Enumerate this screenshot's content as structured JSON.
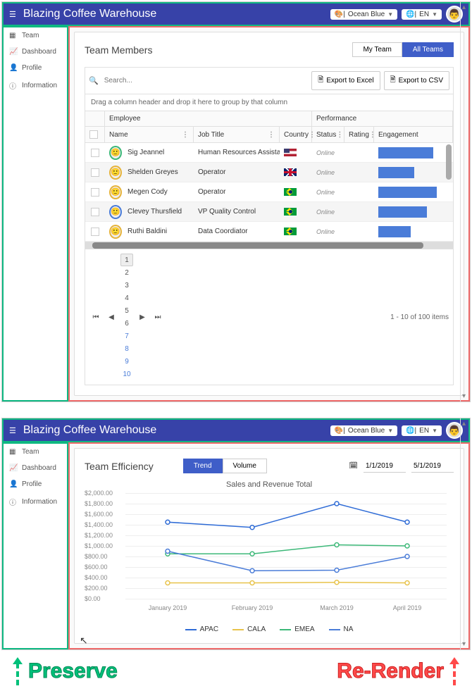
{
  "app_title": "Blazing Coffee Warehouse",
  "theme_dd": "Ocean Blue",
  "lang_dd": "EN",
  "sidebar": {
    "items": [
      {
        "icon": "grid",
        "label": "Team"
      },
      {
        "icon": "chart",
        "label": "Dashboard"
      },
      {
        "icon": "user",
        "label": "Profile"
      },
      {
        "icon": "info",
        "label": "Information"
      }
    ]
  },
  "panel1": {
    "title": "Team Members",
    "seg": {
      "my": "My Team",
      "all": "All Teams"
    },
    "search_placeholder": "Search...",
    "export_excel": "Export to Excel",
    "export_csv": "Export to CSV",
    "group_hint": "Drag a column header and drop it here to group by that column",
    "group_headers": {
      "employee": "Employee",
      "performance": "Performance"
    },
    "headers": {
      "name": "Name",
      "job": "Job Title",
      "country": "Country",
      "status": "Status",
      "rating": "Rating",
      "engagement": "Engagement"
    },
    "rows": [
      {
        "name": "Sig Jeannel",
        "job": "Human Resources Assistant III",
        "flag": "us",
        "status": "Online",
        "eng": 85,
        "ring": "#3cb878"
      },
      {
        "name": "Shelden Greyes",
        "job": "Operator",
        "flag": "uk",
        "status": "Online",
        "eng": 55,
        "ring": "#e6b33a"
      },
      {
        "name": "Megen Cody",
        "job": "Operator",
        "flag": "br",
        "status": "Online",
        "eng": 90,
        "ring": "#e6b33a"
      },
      {
        "name": "Clevey Thursfield",
        "job": "VP Quality Control",
        "flag": "br",
        "status": "Online",
        "eng": 75,
        "ring": "#4a7cd8"
      },
      {
        "name": "Ruthi Baldini",
        "job": "Data Coordiator",
        "flag": "br",
        "status": "Online",
        "eng": 50,
        "ring": "#e6b33a"
      }
    ],
    "pager": {
      "pages": [
        "1",
        "2",
        "3",
        "4",
        "5",
        "6",
        "7",
        "8",
        "9",
        "10"
      ],
      "info": "1 - 10 of 100 items"
    }
  },
  "panel2": {
    "title": "Team Efficiency",
    "seg": {
      "trend": "Trend",
      "volume": "Volume"
    },
    "date_from": "1/1/2019",
    "date_to": "5/1/2019",
    "chart_title": "Sales and Revenue Total"
  },
  "chart_data": {
    "type": "line",
    "title": "Sales and Revenue Total",
    "xlabel": "",
    "ylabel": "",
    "ylim": [
      0,
      2000
    ],
    "yticks": [
      0,
      200,
      400,
      600,
      800,
      1000,
      1200,
      1400,
      1600,
      1800,
      2000
    ],
    "categories": [
      "January 2019",
      "February 2019",
      "March 2019",
      "April 2019"
    ],
    "series": [
      {
        "name": "APAC",
        "color": "#2e6bd6",
        "values": [
          1450,
          1350,
          1800,
          1450
        ]
      },
      {
        "name": "CALA",
        "color": "#e8c34a",
        "values": [
          300,
          300,
          310,
          300
        ]
      },
      {
        "name": "EMEA",
        "color": "#3cb878",
        "values": [
          850,
          850,
          1020,
          1000
        ]
      },
      {
        "name": "NA",
        "color": "#4a7cd8",
        "values": [
          900,
          530,
          540,
          800
        ]
      }
    ]
  },
  "annotations": {
    "preserve": "Preserve",
    "rerender": "Re-Render"
  }
}
